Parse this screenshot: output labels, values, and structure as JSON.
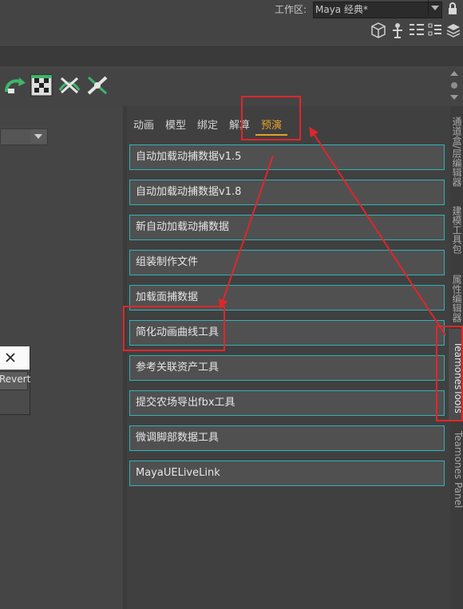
{
  "workspace": {
    "label": "工作区:",
    "value": "Maya 经典*"
  },
  "toolbar_icons": [
    "cube-icon",
    "pivot-icon",
    "list-icon",
    "list-check-icon",
    "layers-icon"
  ],
  "toolbar2_icons": [
    "curve-arrow-icon",
    "checker-icon",
    "snap-icon",
    "cross-icon"
  ],
  "dialog": {
    "revert_label": "Revert"
  },
  "tabs": [
    {
      "label": "动画",
      "active": false
    },
    {
      "label": "模型",
      "active": false
    },
    {
      "label": "绑定",
      "active": false
    },
    {
      "label": "解算",
      "active": false
    },
    {
      "label": "预演",
      "active": true
    }
  ],
  "buttons": [
    {
      "label": "自动加载动捕数据v1.5"
    },
    {
      "label": "自动加载动捕数据v1.8"
    },
    {
      "label": "新自动加载动捕数据"
    },
    {
      "label": "组装制作文件"
    },
    {
      "label": "加载面捕数据"
    },
    {
      "label": "简化动画曲线工具"
    },
    {
      "label": "参考关联资产工具"
    },
    {
      "label": "提交农场导出fbx工具"
    },
    {
      "label": "微调脚部数据工具"
    },
    {
      "label": "MayaUELiveLink"
    }
  ],
  "side_tabs": [
    {
      "label": "通道盒/层编辑器"
    },
    {
      "label": "建模工具包"
    },
    {
      "label": "属性编辑器"
    },
    {
      "label": "TeamonesTools"
    },
    {
      "label": "Teamones Panel"
    }
  ],
  "colors": {
    "accent_orange": "#e6a128",
    "button_border": "#2fb3b9",
    "annotation_red": "#e0262b"
  }
}
